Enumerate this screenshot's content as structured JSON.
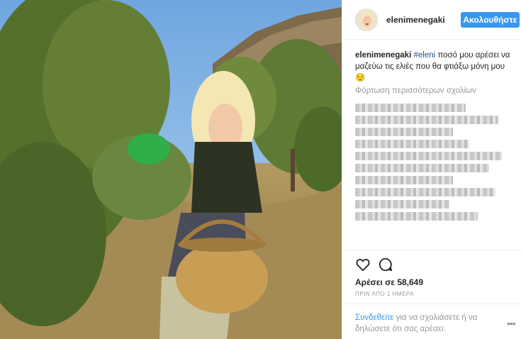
{
  "post": {
    "username": "elenimenegaki",
    "follow_label": "Ακολουθήστε",
    "caption": {
      "author": "elenimenegaki",
      "hashtag": "#eleni",
      "text": " ποσό μου αρέσει να μαζεύω τις ελιές που θα φτιάξω μόνη μου",
      "emoji": "😌"
    },
    "load_more": "Φόρτωση περισσότερων σχολίων",
    "comments_count_visible": 7,
    "likes": "Αρέσει σε 58,649",
    "timestamp": "ΠΡΙΝ ΑΠΟ 1 ΗΜΕΡΑ",
    "login_prompt": {
      "link": "Συνδεθείτε",
      "text": " για να σχολιάσετε ή να δηλώσετε ότι σας αρέσει."
    },
    "more_icon": "•••"
  },
  "icons": [
    "heart-icon",
    "comment-icon",
    "more-options-icon"
  ],
  "colors": {
    "accent": "#3897f0",
    "hashtag": "#1d4f8a",
    "muted": "#999999"
  }
}
